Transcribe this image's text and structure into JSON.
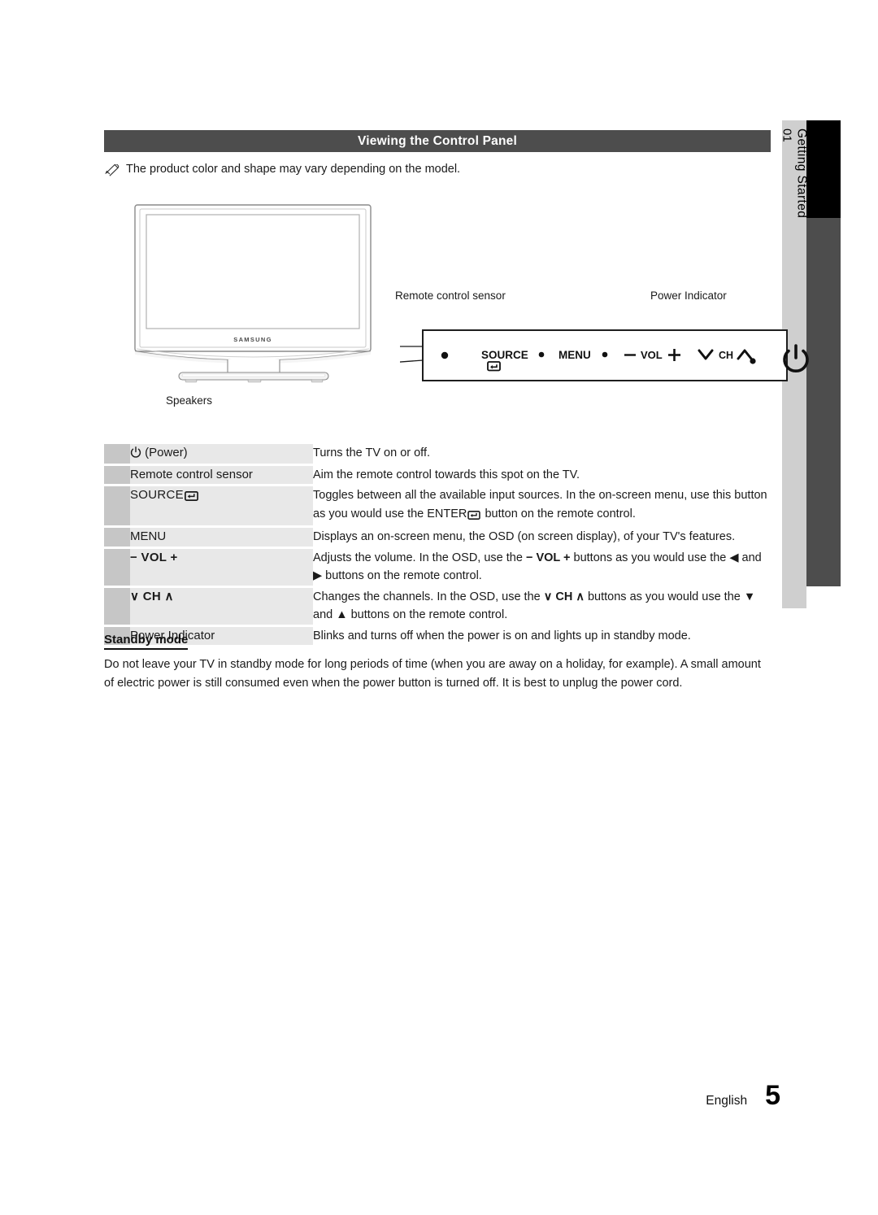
{
  "page": {
    "section_number": "01",
    "section_name": "Getting Started",
    "header_title": "Viewing the Control Panel",
    "note": "The product color and shape may vary depending on the model.",
    "language": "English",
    "page_number": "5"
  },
  "figure": {
    "tv_brand": "SAMSUNG",
    "speakers_label": "Speakers",
    "remote_sensor_label": "Remote control sensor",
    "power_indicator_label": "Power Indicator",
    "panel_buttons": {
      "source": "SOURCE",
      "menu": "MENU",
      "vol": "VOL",
      "vol_minus": "−",
      "vol_plus": "+",
      "ch": "CH"
    }
  },
  "table": {
    "rows": [
      {
        "label_prefix": "",
        "label": "(Power)",
        "icon": "power-icon",
        "desc_parts": [
          {
            "text": "Turns the TV on or off."
          }
        ]
      },
      {
        "label": "Remote control sensor",
        "icon": "",
        "desc_parts": [
          {
            "text": "Aim the remote control towards this spot on the TV."
          }
        ]
      },
      {
        "label": "SOURCE",
        "icon": "enter-icon",
        "desc_parts": [
          {
            "text": "Toggles between all the available input sources. In the on-screen menu, use this button as you would use the "
          },
          {
            "text": "ENTER",
            "style": "strong"
          },
          {
            "text": "enter-icon",
            "style": "icon"
          },
          {
            "text": " button on the remote control."
          }
        ]
      },
      {
        "label": "MENU",
        "icon": "",
        "desc_parts": [
          {
            "text": "Displays an on-screen menu, the OSD (on screen display), of your TV's features."
          }
        ]
      },
      {
        "label": "− VOL +",
        "icon": "",
        "desc_parts": [
          {
            "text": "Adjusts the volume. In the OSD, use the "
          },
          {
            "text": "− VOL +",
            "style": "strong"
          },
          {
            "text": " buttons as you would use the ◀ and ▶ buttons on the remote control."
          }
        ]
      },
      {
        "label": "∨ CH ∧",
        "icon": "",
        "desc_parts": [
          {
            "text": "Changes the channels. In the OSD, use the "
          },
          {
            "text": "∨ CH ∧",
            "style": "strong"
          },
          {
            "text": " buttons as you would use the ▼ and ▲ buttons on the remote control."
          }
        ]
      },
      {
        "label": "Power Indicator",
        "icon": "",
        "desc_parts": [
          {
            "text": "Blinks and turns off when the power is on and lights up in standby mode."
          }
        ]
      }
    ],
    "row_labels_plain": [
      "(Power)",
      "Remote control sensor",
      "SOURCE",
      "MENU",
      "− VOL +",
      "∨ CH ∧",
      "Power Indicator"
    ],
    "row_descs_plain": [
      "Turns the TV on or off.",
      "Aim the remote control towards this spot on the TV.",
      "Toggles between all the available input sources. In the on-screen menu, use this button as you would use the ENTER button on the remote control.",
      "Displays an on-screen menu, the OSD (on screen display), of your TV's features.",
      "Adjusts the volume. In the OSD, use the − VOL + buttons as you would use the ◀ and ▶ buttons on the remote control.",
      "Changes the channels. In the OSD, use the ∨ CH ∧ buttons as you would use the ▼ and ▲ buttons on the remote control.",
      "Blinks and turns off when the power is on and lights up in standby mode."
    ]
  },
  "standby": {
    "title": "Standby mode",
    "body": "Do not leave your TV in standby mode for long periods of time (when you are away on a holiday, for example). A small amount of electric power is still consumed even when the power button is turned off. It is best to unplug the power cord."
  },
  "colors": {
    "header_bg": "#4d4d4d",
    "tab_bg": "#cfcfcf",
    "tab_black": "#000000",
    "tab_gray": "#4d4d4d",
    "row_swatch": "#c6c6c6",
    "row_label_bg": "#e8e8e8"
  }
}
